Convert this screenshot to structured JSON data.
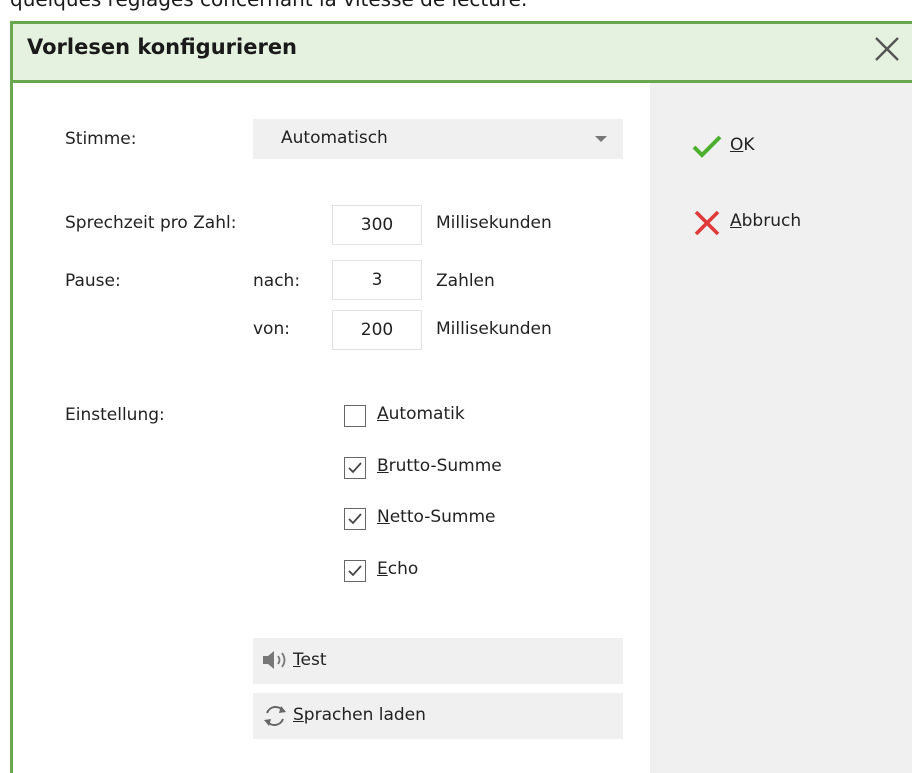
{
  "caption_above": "quelques réglages concernant la vitesse de lecture.",
  "dialog": {
    "title": "Vorlesen konfigurieren"
  },
  "form": {
    "voice_label": "Stimme:",
    "voice_value": "Automatisch",
    "speak_time_label": "Sprechzeit pro Zahl:",
    "speak_time_value": "300",
    "speak_time_unit": "Millisekunden",
    "pause_label": "Pause:",
    "after_label": "nach:",
    "after_value": "3",
    "after_unit": "Zahlen",
    "duration_label": "von:",
    "duration_value": "200",
    "duration_unit": "Millisekunden",
    "setting_label": "Einstellung:"
  },
  "checkboxes": [
    {
      "first": "A",
      "rest": "utomatik",
      "checked": false
    },
    {
      "first": "B",
      "rest": "rutto-Summe",
      "checked": true
    },
    {
      "first": "N",
      "rest": "etto-Summe",
      "checked": true
    },
    {
      "first": "E",
      "rest": "cho",
      "checked": true
    }
  ],
  "buttons": {
    "test_first": "T",
    "test_rest": "est",
    "load_first": "S",
    "load_rest": "prachen laden"
  },
  "actions": {
    "ok_first": "O",
    "ok_rest": "K",
    "cancel_first": "A",
    "cancel_rest": "bbruch"
  },
  "colors": {
    "accent_green": "#6aa84f",
    "ok_green": "#4caf2e",
    "cancel_red": "#e03a3a"
  }
}
